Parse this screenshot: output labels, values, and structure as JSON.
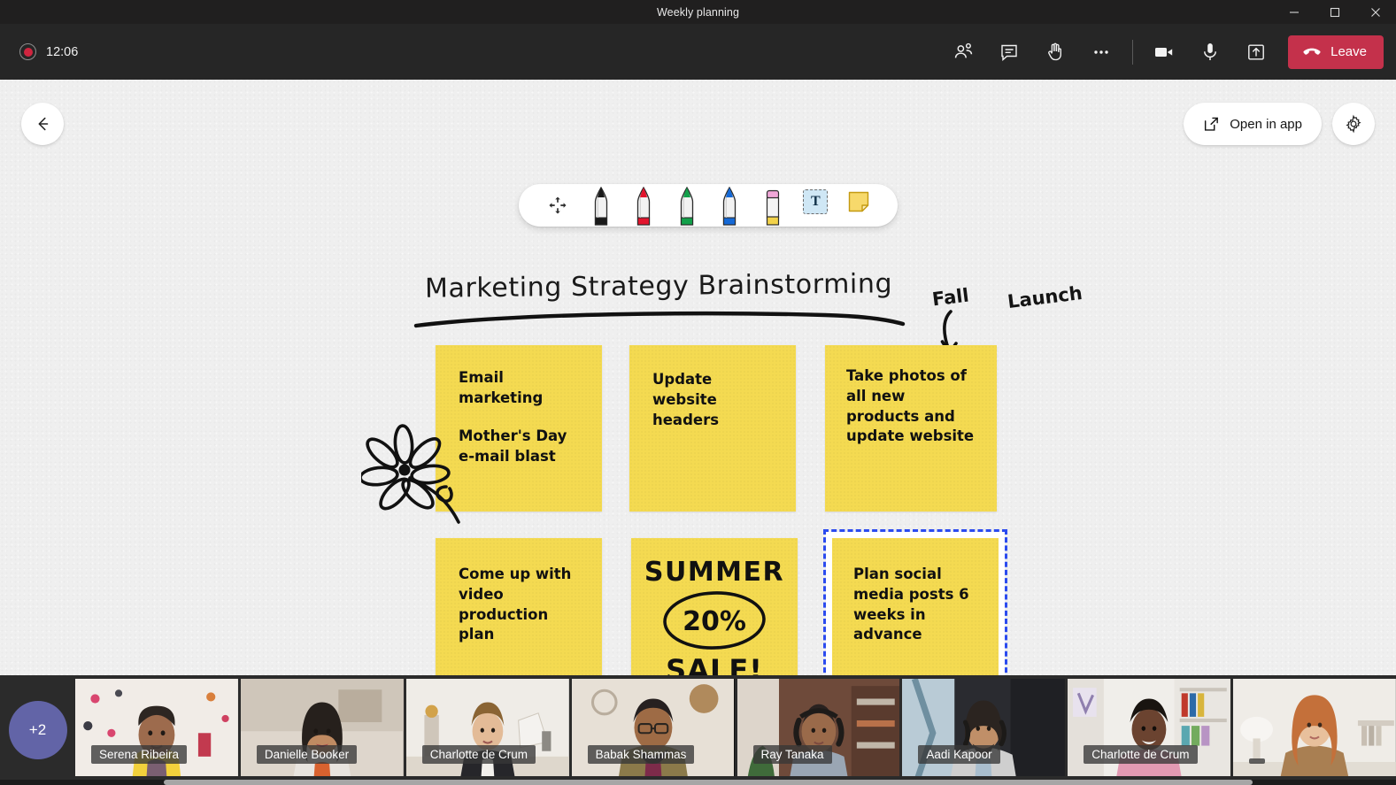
{
  "window": {
    "title": "Weekly planning",
    "controls": [
      {
        "name": "minimize",
        "glyph": "minimize-icon"
      },
      {
        "name": "maximize",
        "glyph": "maximize-icon"
      },
      {
        "name": "close",
        "glyph": "close-icon"
      }
    ]
  },
  "meeting_bar": {
    "recording_indicator": "recording-icon",
    "elapsed_time": "12:06",
    "actions": [
      {
        "name": "people-icon",
        "label": "People"
      },
      {
        "name": "chat-icon",
        "label": "Chat"
      },
      {
        "name": "raise-hand-icon",
        "label": "Raise hand"
      },
      {
        "name": "more-options-icon",
        "label": "More options"
      },
      {
        "name": "camera-icon",
        "label": "Camera"
      },
      {
        "name": "microphone-icon",
        "label": "Microphone"
      },
      {
        "name": "share-screen-icon",
        "label": "Share"
      }
    ],
    "leave_label": "Leave",
    "leave_color": "#c4314b"
  },
  "whiteboard": {
    "back_button": "back-arrow-icon",
    "open_in_app_label": "Open in app",
    "settings_icon": "gear-icon",
    "background_color": "#efefef",
    "toolbar": {
      "tools": [
        {
          "name": "move-tool",
          "icon": "move-icon",
          "selected": false
        },
        {
          "name": "pen-black",
          "icon": "pen-icon",
          "color": "#1a1a1a",
          "selected": false
        },
        {
          "name": "pen-red",
          "icon": "pen-icon",
          "color": "#e2142d",
          "selected": false
        },
        {
          "name": "pen-green",
          "icon": "pen-icon",
          "color": "#12a04a",
          "selected": false
        },
        {
          "name": "pen-blue",
          "icon": "pen-icon",
          "color": "#1569d6",
          "selected": false
        },
        {
          "name": "highlighter",
          "icon": "highlighter-icon",
          "color": "#f0a7d8",
          "selected": false
        },
        {
          "name": "text-tool",
          "icon": "text-icon",
          "label": "T",
          "selected": true
        },
        {
          "name": "sticky-note-tool",
          "icon": "sticky-note-icon",
          "color": "#f4da51",
          "selected": false
        }
      ]
    },
    "title_text": "Marketing Strategy Brainstorming",
    "annotation": {
      "line1": "Fall",
      "line2": "Launch"
    },
    "notes": [
      {
        "id": "note-email-marketing",
        "color": "#f4da51",
        "selected": false,
        "paragraphs": [
          "Email marketing",
          "Mother's Day e-mail blast"
        ]
      },
      {
        "id": "note-update-website-headers",
        "color": "#f4da51",
        "selected": false,
        "paragraphs": [
          "Update website headers"
        ]
      },
      {
        "id": "note-take-photos",
        "color": "#f4da51",
        "selected": false,
        "paragraphs": [
          "Take photos of all new products and update website"
        ]
      },
      {
        "id": "note-video-production",
        "color": "#f4da51",
        "selected": false,
        "paragraphs": [
          "Come up with video production plan"
        ]
      },
      {
        "id": "note-summer-sale",
        "color": "#f4da51",
        "selected": false,
        "handwritten": true,
        "lines": [
          "SUMMER",
          "20%",
          "SALE!"
        ]
      },
      {
        "id": "note-plan-social-media",
        "color": "#f4da51",
        "selected": true,
        "paragraphs": [
          "Plan social media posts 6 weeks in advance"
        ]
      }
    ]
  },
  "filmstrip": {
    "overflow_count": "+2",
    "overflow_color": "#6264a7",
    "participants": [
      {
        "name": "Serena Ribeira"
      },
      {
        "name": "Danielle Booker"
      },
      {
        "name": "Charlotte de Crum"
      },
      {
        "name": "Babak Shammas"
      },
      {
        "name": "Ray Tanaka"
      },
      {
        "name": "Aadi Kapoor"
      },
      {
        "name": "Charlotte de Crum"
      },
      {
        "name": ""
      }
    ]
  }
}
